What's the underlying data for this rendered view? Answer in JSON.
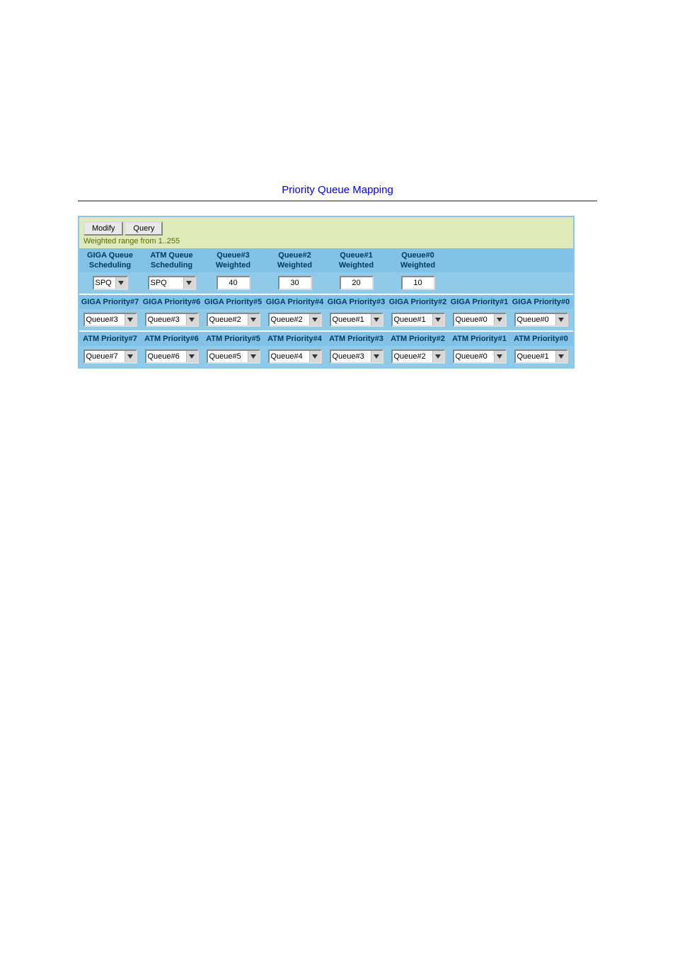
{
  "title": "Priority Queue Mapping",
  "toolbar": {
    "modify": "Modify",
    "query": "Query",
    "hint": "Weighted range from 1..255"
  },
  "schedulingSection": {
    "headers": {
      "gigaSched": "GIGA Queue Scheduling",
      "atmSched": "ATM Queue Scheduling",
      "q3w": "Queue#3 Weighted",
      "q2w": "Queue#2 Weighted",
      "q1w": "Queue#1 Weighted",
      "q0w": "Queue#0 Weighted"
    },
    "controls": {
      "gigaSchedVal": "SPQ",
      "atmSchedVal": "SPQ",
      "w3": "40",
      "w2": "30",
      "w1": "20",
      "w0": "10"
    }
  },
  "gigaPriority": {
    "headers": {
      "p7": "GIGA Priority#7",
      "p6": "GIGA Priority#6",
      "p5": "GIGA Priority#5",
      "p4": "GIGA Priority#4",
      "p3": "GIGA Priority#3",
      "p2": "GIGA Priority#2",
      "p1": "GIGA Priority#1",
      "p0": "GIGA Priority#0"
    },
    "values": {
      "p7": "Queue#3",
      "p6": "Queue#3",
      "p5": "Queue#2",
      "p4": "Queue#2",
      "p3": "Queue#1",
      "p2": "Queue#1",
      "p1": "Queue#0",
      "p0": "Queue#0"
    }
  },
  "atmPriority": {
    "headers": {
      "p7": "ATM Priority#7",
      "p6": "ATM Priority#6",
      "p5": "ATM Priority#5",
      "p4": "ATM Priority#4",
      "p3": "ATM Priority#3",
      "p2": "ATM Priority#2",
      "p1": "ATM Priority#1",
      "p0": "ATM Priority#0"
    },
    "values": {
      "p7": "Queue#7",
      "p6": "Queue#6",
      "p5": "Queue#5",
      "p4": "Queue#4",
      "p3": "Queue#3",
      "p2": "Queue#2",
      "p1": "Queue#0",
      "p0": "Queue#1"
    }
  }
}
